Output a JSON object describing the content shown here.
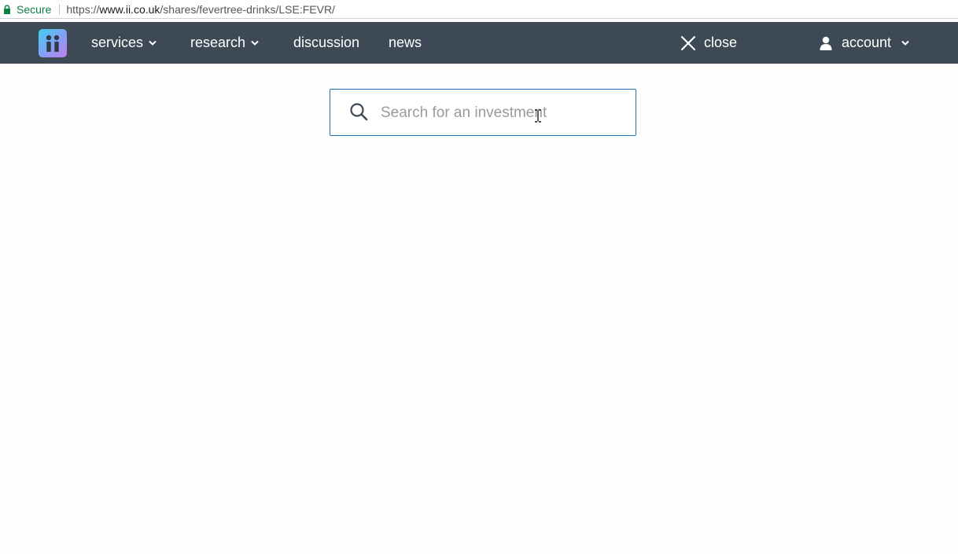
{
  "browser": {
    "secure_label": "Secure",
    "url_scheme": "https://",
    "url_host": "www.ii.co.uk",
    "url_path": "/shares/fevertree-drinks/LSE:FEVR/"
  },
  "nav": {
    "logo_icon": "ii-logo",
    "items": [
      {
        "label": "services",
        "has_dropdown": true
      },
      {
        "label": "research",
        "has_dropdown": true
      },
      {
        "label": "discussion",
        "has_dropdown": false
      },
      {
        "label": "news",
        "has_dropdown": false
      }
    ],
    "close_label": "close",
    "account_label": "account"
  },
  "search": {
    "placeholder": "Search for an investment",
    "value": ""
  },
  "colors": {
    "nav_bg": "#3d4a55",
    "search_border": "#1f6fb6",
    "secure_green": "#0b8043"
  }
}
